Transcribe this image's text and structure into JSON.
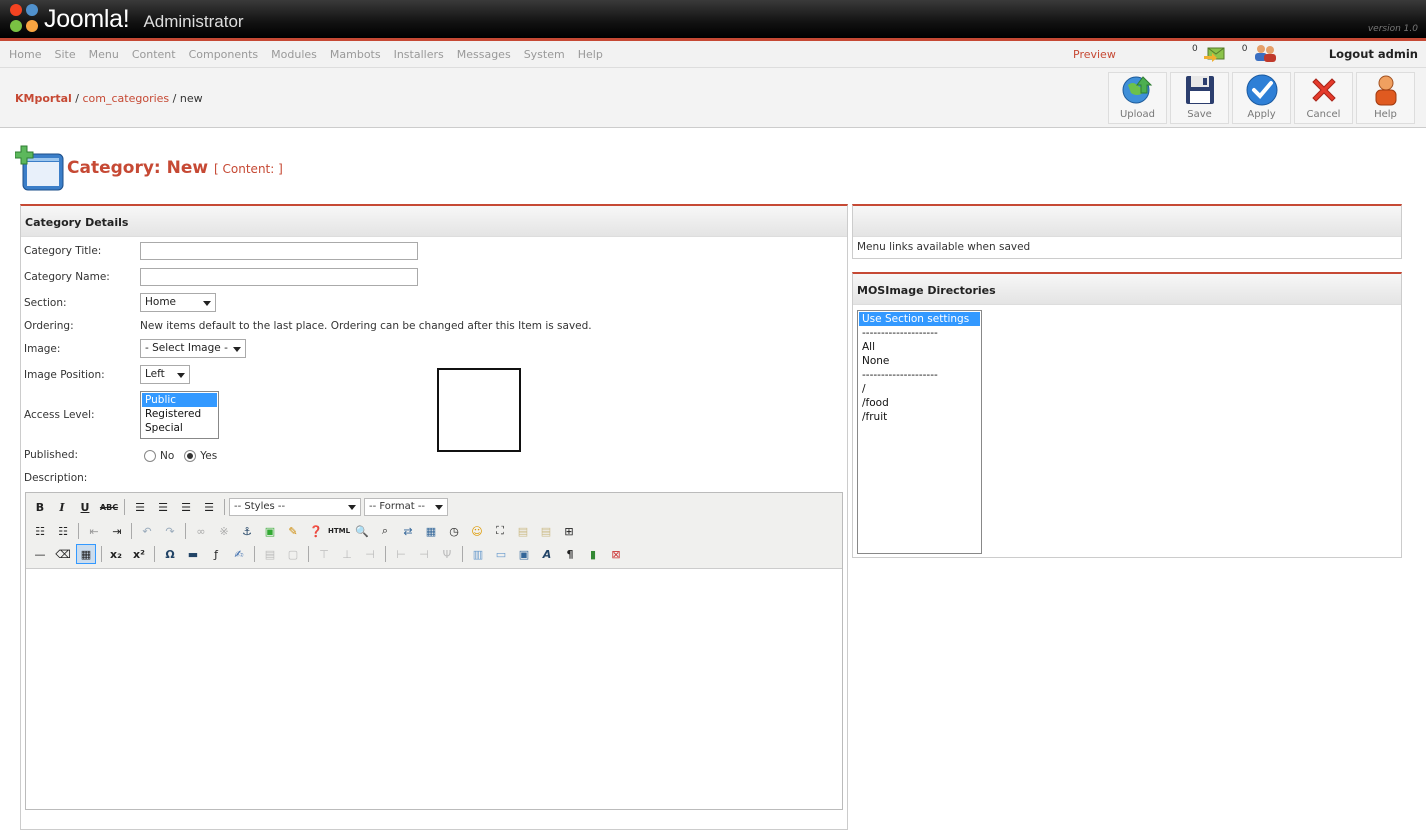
{
  "header": {
    "brand": "Joomla!",
    "subtitle": "Administrator",
    "version": "version 1.0"
  },
  "menu": {
    "items": [
      "Home",
      "Site",
      "Menu",
      "Content",
      "Components",
      "Modules",
      "Mambots",
      "Installers",
      "Messages",
      "System",
      "Help"
    ]
  },
  "status": {
    "preview": "Preview",
    "messages_count": "0",
    "users_count": "0",
    "logout": "Logout admin"
  },
  "breadcrumb": {
    "site": "KMportal",
    "component": "com_categories",
    "current": "new",
    "sep": "/"
  },
  "toolbar": {
    "upload": "Upload",
    "save": "Save",
    "apply": "Apply",
    "cancel": "Cancel",
    "help": "Help"
  },
  "page": {
    "title": "Category:",
    "title_action": "New",
    "context": "[ Content: ]"
  },
  "details": {
    "heading": "Category Details",
    "title_label": "Category Title:",
    "name_label": "Category Name:",
    "section_label": "Section:",
    "section_value": "Home",
    "ordering_label": "Ordering:",
    "ordering_note": "New items default to the last place. Ordering can be changed after this Item is saved.",
    "image_label": "Image:",
    "image_value": "- Select Image -",
    "position_label": "Image Position:",
    "position_value": "Left",
    "access_label": "Access Level:",
    "access_options": [
      "Public",
      "Registered",
      "Special"
    ],
    "published_label": "Published:",
    "published_no": "No",
    "published_yes": "Yes",
    "description_label": "Description:"
  },
  "editor": {
    "styles": "-- Styles --",
    "format": "-- Format --"
  },
  "menu_links": {
    "note": "Menu links available when saved"
  },
  "mosimage": {
    "heading": "MOSImage Directories",
    "options": [
      "Use Section settings",
      "--------------------",
      "All",
      "None",
      "--------------------",
      "/",
      "/food",
      "/fruit"
    ]
  },
  "colors": {
    "accent": "#c64934",
    "select_highlight": "#3399ff"
  }
}
